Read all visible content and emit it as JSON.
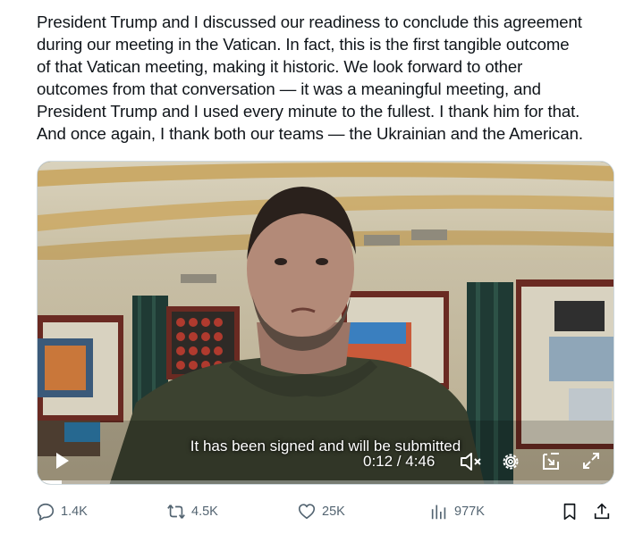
{
  "tweet": {
    "lines": [
      "President Trump and I discussed our readiness to conclude this agreement",
      "during our meeting in the Vatican. In fact, this is the first tangible outcome",
      "of that Vatican meeting, making it historic. We look forward to other",
      "outcomes from that conversation — it was a meaningful meeting, and",
      "President Trump and I used every minute to the fullest. I thank him for that.",
      "And once again, I thank both our teams — the Ukrainian and the American."
    ]
  },
  "video": {
    "caption": "It has been signed and will be submitted",
    "time": "0:12 / 4:46",
    "progress": 0.042,
    "icons": {
      "play": "play-icon",
      "mute": "volume-muted-icon",
      "settings": "gear-icon",
      "dock": "dock-icon",
      "fullscreen": "fullscreen-icon"
    }
  },
  "actions": {
    "replies": "1.4K",
    "reposts": "4.5K",
    "likes": "25K",
    "views": "977K"
  },
  "colors": {
    "text": "#0f1419",
    "muted": "#536471",
    "border": "#cfd9de"
  }
}
